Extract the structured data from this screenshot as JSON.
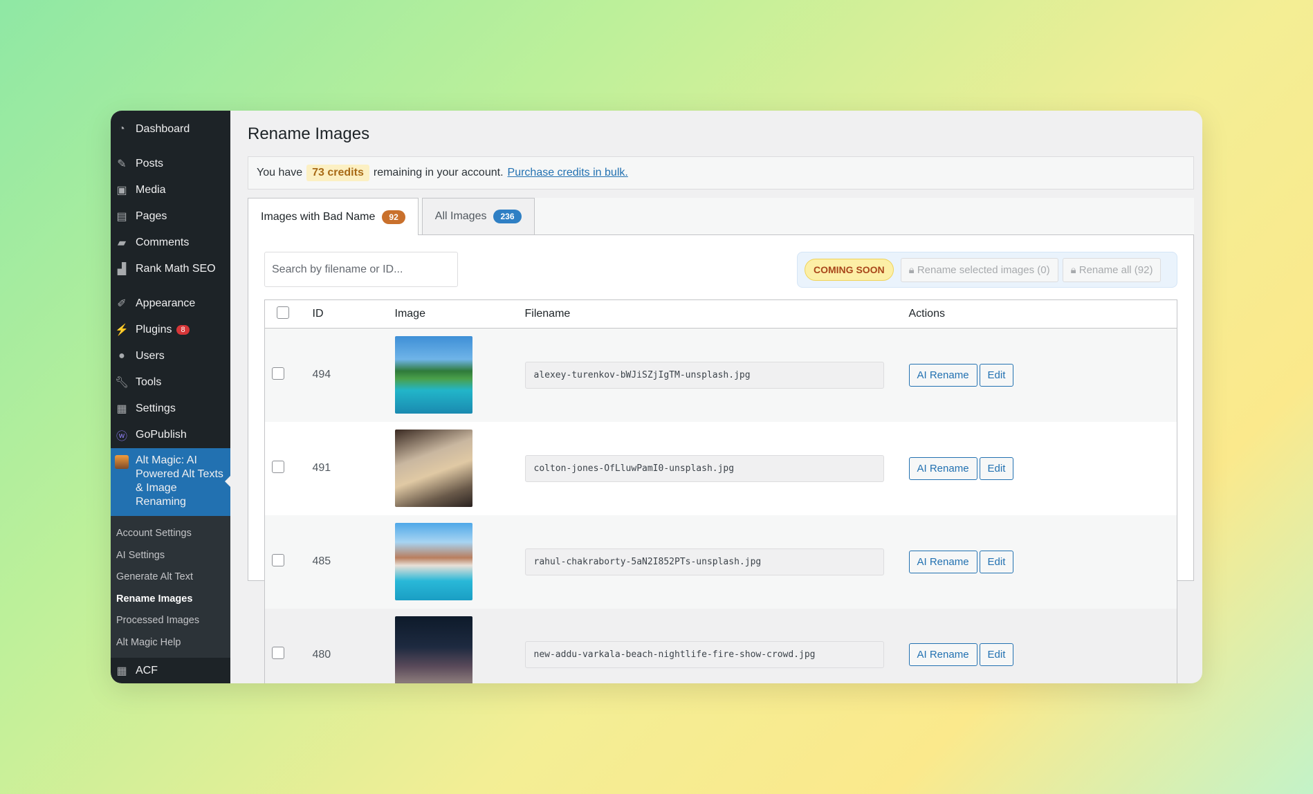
{
  "sidebar": {
    "items": [
      {
        "label": "Dashboard",
        "icon": "dashboard-icon"
      },
      {
        "label": "Posts",
        "icon": "pin-icon"
      },
      {
        "label": "Media",
        "icon": "media-icon"
      },
      {
        "label": "Pages",
        "icon": "pages-icon"
      },
      {
        "label": "Comments",
        "icon": "comments-icon"
      },
      {
        "label": "Rank Math SEO",
        "icon": "rank-math-icon"
      },
      {
        "label": "Appearance",
        "icon": "brush-icon"
      },
      {
        "label": "Plugins",
        "icon": "plugin-icon",
        "badge": "8"
      },
      {
        "label": "Users",
        "icon": "user-icon"
      },
      {
        "label": "Tools",
        "icon": "wrench-icon"
      },
      {
        "label": "Settings",
        "icon": "settings-icon"
      },
      {
        "label": "GoPublish",
        "icon": "gopublish-icon"
      }
    ],
    "active": "Alt Magic: AI Powered Alt Texts & Image Renaming",
    "submenu": [
      "Account Settings",
      "AI Settings",
      "Generate Alt Text",
      "Rename Images",
      "Processed Images",
      "Alt Magic Help"
    ],
    "last": "ACF"
  },
  "page": {
    "title": "Rename Images"
  },
  "notice": {
    "prefix": "You have",
    "credits": "73 credits",
    "suffix": "remaining in your account.",
    "link": "Purchase credits in bulk."
  },
  "tabs": [
    {
      "label": "Images with Bad Name",
      "count": "92",
      "color": "#c9702c"
    },
    {
      "label": "All Images",
      "count": "236",
      "color": "#2f7fc4"
    }
  ],
  "search": {
    "placeholder": "Search by filename or ID...",
    "value": ""
  },
  "actions": {
    "coming_soon": "COMING SOON",
    "rename_selected": "Rename selected images (0)",
    "rename_all": "Rename all (92)",
    "lock_icon": "lock-icon"
  },
  "table": {
    "headers": {
      "id": "ID",
      "image": "Image",
      "filename": "Filename",
      "actions": "Actions"
    },
    "rows": [
      {
        "id": "494",
        "filename": "alexey-turenkov-bWJiSZjIgTM-unsplash.jpg"
      },
      {
        "id": "491",
        "filename": "colton-jones-OfLluwPamI0-unsplash.jpg"
      },
      {
        "id": "485",
        "filename": "rahul-chakraborty-5aN2I852PTs-unsplash.jpg"
      },
      {
        "id": "480",
        "filename": "new-addu-varkala-beach-nightlife-fire-show-crowd.jpg"
      }
    ],
    "ai_rename": "AI Rename",
    "edit": "Edit"
  }
}
